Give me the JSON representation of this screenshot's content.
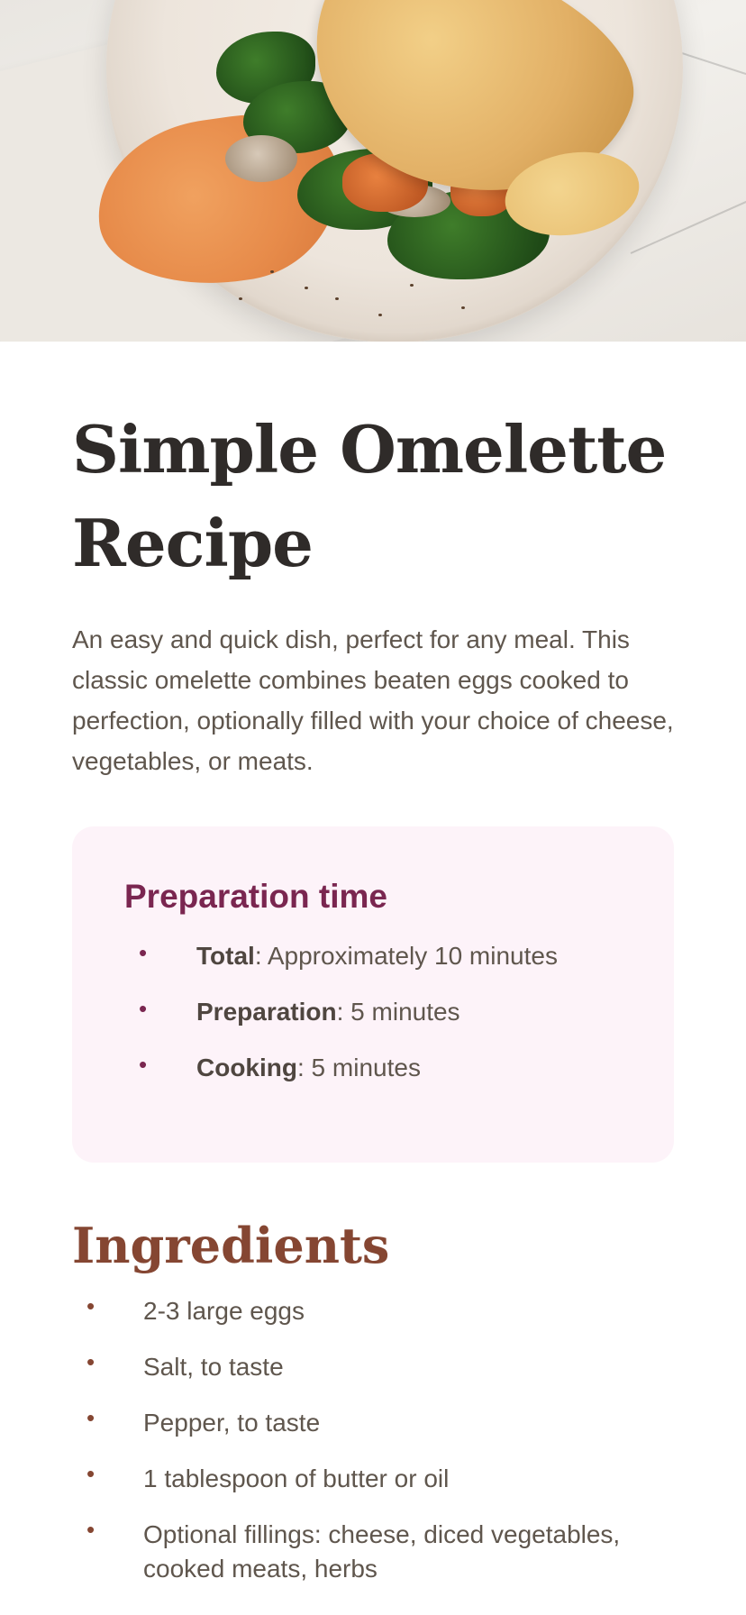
{
  "hero": {
    "image_name": "omelette-photo"
  },
  "recipe": {
    "title": "Simple Omelette Recipe",
    "intro": "An easy and quick dish, perfect for any meal. This classic omelette combines beaten eggs cooked to perfection, optionally filled with your choice of cheese, vegetables, or meats."
  },
  "preparation": {
    "title": "Preparation time",
    "items": [
      {
        "label": "Total",
        "value": ": Approximately 10 minutes"
      },
      {
        "label": "Preparation",
        "value": ": 5 minutes"
      },
      {
        "label": "Cooking",
        "value": ": 5 minutes"
      }
    ],
    "bullet": "•"
  },
  "ingredients": {
    "title": "Ingredients",
    "bullet": "•",
    "items": [
      "2-3 large eggs",
      "Salt, to taste",
      "Pepper, to taste",
      "1 tablespoon of butter or oil",
      "Optional fillings: cheese, diced vegetables, cooked meats, herbs"
    ]
  },
  "colors": {
    "prep_title": "#7a2650",
    "prep_bg": "#fdf3f9",
    "ingredients_title": "#854632",
    "heading": "#2f2b29",
    "body_text": "#5f564d"
  }
}
